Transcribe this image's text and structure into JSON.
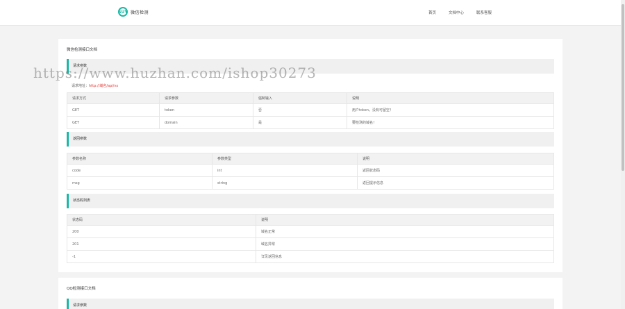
{
  "header": {
    "logo_mark": "SUY",
    "logo_text": "微信检测",
    "nav": [
      "首页",
      "文档中心",
      "联系客服"
    ]
  },
  "wechat_doc": {
    "title": "微信检测接口文档",
    "request_section": "请求参数",
    "address_label": "请求地址：",
    "address_url": "http://域名/api/vx",
    "request_headers": [
      "请求方式",
      "请求参数",
      "强制输入",
      "说明"
    ],
    "request_rows": [
      [
        "GET",
        "token",
        "否",
        "用户token，没有可留空！"
      ],
      [
        "GET",
        "domain",
        "是",
        "要检测的域名！"
      ]
    ],
    "return_section": "返回参数",
    "return_headers": [
      "参数名称",
      "参数类型",
      "说明"
    ],
    "return_rows": [
      [
        "code",
        "int",
        "返回状态码"
      ],
      [
        "msg",
        "string",
        "返回提示信息"
      ]
    ],
    "status_section": "状态码列表",
    "status_headers": [
      "状态码",
      "说明"
    ],
    "status_rows": [
      [
        "200",
        "域名正常"
      ],
      [
        "201",
        "域名异常"
      ],
      [
        "-1",
        "详见返回信息"
      ]
    ]
  },
  "qq_doc": {
    "title": "QQ检测接口文档",
    "request_section": "请求参数"
  },
  "watermark": "https://www.huzhan.com/ishop30273",
  "colors": {
    "accent": "#1bb7a5",
    "url": "#e53935"
  }
}
